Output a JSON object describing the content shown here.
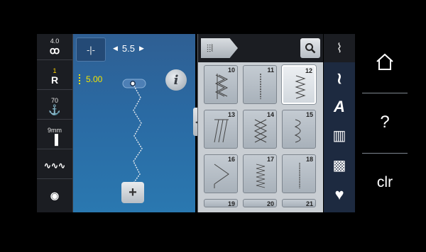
{
  "left_toolbar": {
    "items": [
      {
        "top_label": "4.0",
        "glyph_label": "ꝏ",
        "icon": "upper-thread-tension-icon"
      },
      {
        "top_label": "1",
        "glyph_label": "R",
        "icon": "presser-foot-icon"
      },
      {
        "top_label": "70",
        "glyph_label": "⚓",
        "icon": "presser-foot-pressure-icon"
      },
      {
        "top_label": "9mm",
        "glyph_label": "▐",
        "icon": "needle-plate-icon"
      },
      {
        "top_label": "",
        "glyph_label": "∿∿∿",
        "icon": "feed-dog-icon"
      },
      {
        "top_label": "",
        "glyph_label": "◉",
        "icon": "bobbin-icon"
      }
    ]
  },
  "preview": {
    "needle_position_label": "-|-",
    "stitch_width": "5.5",
    "stitch_length": "5.00",
    "info_label": "i",
    "add_label": "+"
  },
  "panel": {
    "category_tab_label": "⦙⦙⦚",
    "collapse_label": "◀",
    "stitches": [
      {
        "number": "10",
        "selected": false,
        "pattern": "zigzag-triple"
      },
      {
        "number": "11",
        "selected": false,
        "pattern": "straight-dotted"
      },
      {
        "number": "12",
        "selected": true,
        "pattern": "zigzag-narrow"
      },
      {
        "number": "13",
        "selected": false,
        "pattern": "slant"
      },
      {
        "number": "14",
        "selected": false,
        "pattern": "cross"
      },
      {
        "number": "15",
        "selected": false,
        "pattern": "serpentine"
      },
      {
        "number": "16",
        "selected": false,
        "pattern": "wide-zigzag"
      },
      {
        "number": "17",
        "selected": false,
        "pattern": "zigzag-tight"
      },
      {
        "number": "18",
        "selected": false,
        "pattern": "straight-short"
      },
      {
        "number": "19",
        "selected": false,
        "pattern": "partial"
      },
      {
        "number": "20",
        "selected": false,
        "pattern": "partial"
      },
      {
        "number": "21",
        "selected": false,
        "pattern": "partial"
      }
    ]
  },
  "categories": {
    "items": [
      {
        "label": "⌇",
        "icon": "practical-stitches-icon"
      },
      {
        "label": "≀",
        "icon": "decorative-stitches-icon"
      },
      {
        "label": "A",
        "icon": "alphabets-icon"
      },
      {
        "label": "▥",
        "icon": "buttonholes-icon"
      },
      {
        "label": "▩",
        "icon": "quilt-stitches-icon"
      },
      {
        "label": "♥",
        "icon": "personal-program-icon"
      }
    ]
  },
  "system": {
    "home_label": "⌂",
    "help_label": "?",
    "clear_label": "clr"
  },
  "colors": {
    "preview_bg": "#2a6aa3",
    "length_value": "#f2e400",
    "tension_yellow": "#ffd400",
    "panel_bg": "#c9ced3"
  }
}
